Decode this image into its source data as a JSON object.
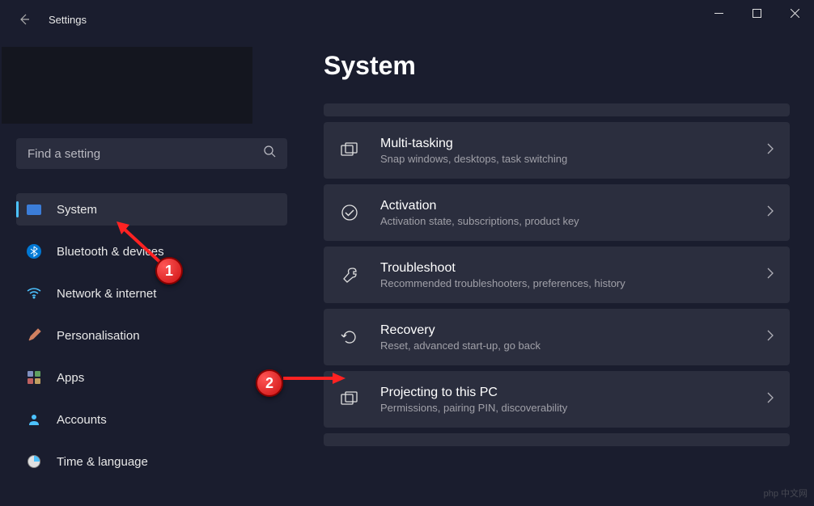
{
  "titlebar": {
    "title": "Settings"
  },
  "search": {
    "placeholder": "Find a setting"
  },
  "nav": {
    "items": [
      {
        "label": "System",
        "icon": "monitor",
        "active": true
      },
      {
        "label": "Bluetooth & devices",
        "icon": "bluetooth"
      },
      {
        "label": "Network & internet",
        "icon": "wifi"
      },
      {
        "label": "Personalisation",
        "icon": "brush"
      },
      {
        "label": "Apps",
        "icon": "apps"
      },
      {
        "label": "Accounts",
        "icon": "person"
      },
      {
        "label": "Time & language",
        "icon": "clock"
      }
    ]
  },
  "page": {
    "title": "System"
  },
  "settings": {
    "items": [
      {
        "title": "Multi-tasking",
        "desc": "Snap windows, desktops, task switching",
        "icon": "multitask"
      },
      {
        "title": "Activation",
        "desc": "Activation state, subscriptions, product key",
        "icon": "check"
      },
      {
        "title": "Troubleshoot",
        "desc": "Recommended troubleshooters, preferences, history",
        "icon": "wrench"
      },
      {
        "title": "Recovery",
        "desc": "Reset, advanced start-up, go back",
        "icon": "recovery"
      },
      {
        "title": "Projecting to this PC",
        "desc": "Permissions, pairing PIN, discoverability",
        "icon": "project"
      }
    ]
  },
  "callouts": {
    "one": "1",
    "two": "2"
  }
}
